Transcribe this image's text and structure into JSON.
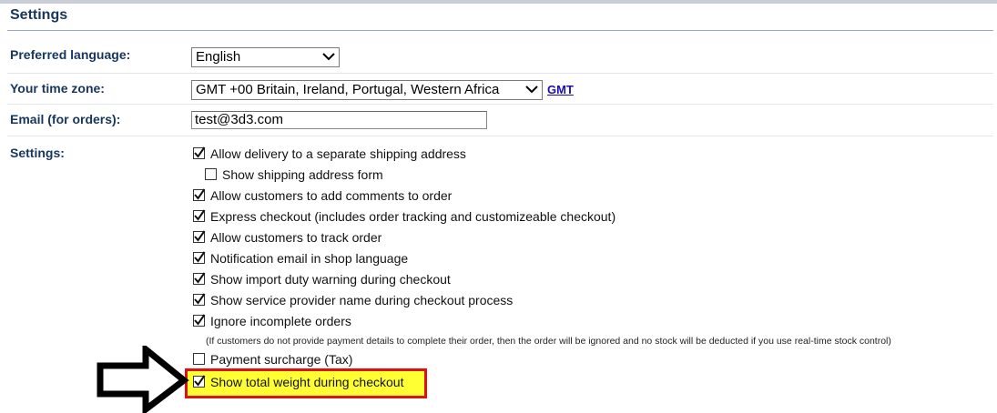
{
  "section": {
    "title": "Settings"
  },
  "fields": {
    "language": {
      "label": "Preferred language:",
      "value": "English"
    },
    "timezone": {
      "label": "Your time zone:",
      "value": "GMT +00 Britain, Ireland, Portugal, Western Africa",
      "link": "GMT"
    },
    "email": {
      "label": "Email (for orders):",
      "value": "test@3d3.com"
    },
    "settings": {
      "label": "Settings:"
    }
  },
  "options": [
    {
      "label": "Allow delivery to a separate shipping address",
      "checked": true
    },
    {
      "label": "Show shipping address form",
      "checked": false
    },
    {
      "label": "Allow customers to add comments to order",
      "checked": true
    },
    {
      "label": "Express checkout (includes order tracking and customizeable checkout)",
      "checked": true
    },
    {
      "label": "Allow customers to track order",
      "checked": true
    },
    {
      "label": "Notification email in shop language",
      "checked": true
    },
    {
      "label": "Show import duty warning during checkout",
      "checked": true
    },
    {
      "label": "Show service provider name during checkout process",
      "checked": true
    },
    {
      "label": "Ignore incomplete orders",
      "checked": true
    },
    {
      "label": "Payment surcharge (Tax)",
      "checked": false
    },
    {
      "label": "Show total weight during checkout",
      "checked": true
    }
  ],
  "ignore_note": "(If customers do not provide payment details to complete their order, then the order will be ignored and no stock will be deducted if you use real-time stock control)",
  "colors": {
    "highlight_fill": "#ffff33",
    "highlight_border": "#e01010",
    "heading": "#17365d",
    "link": "#1a0dab"
  },
  "annotation": {
    "arrow_icon": "right-arrow-icon"
  }
}
